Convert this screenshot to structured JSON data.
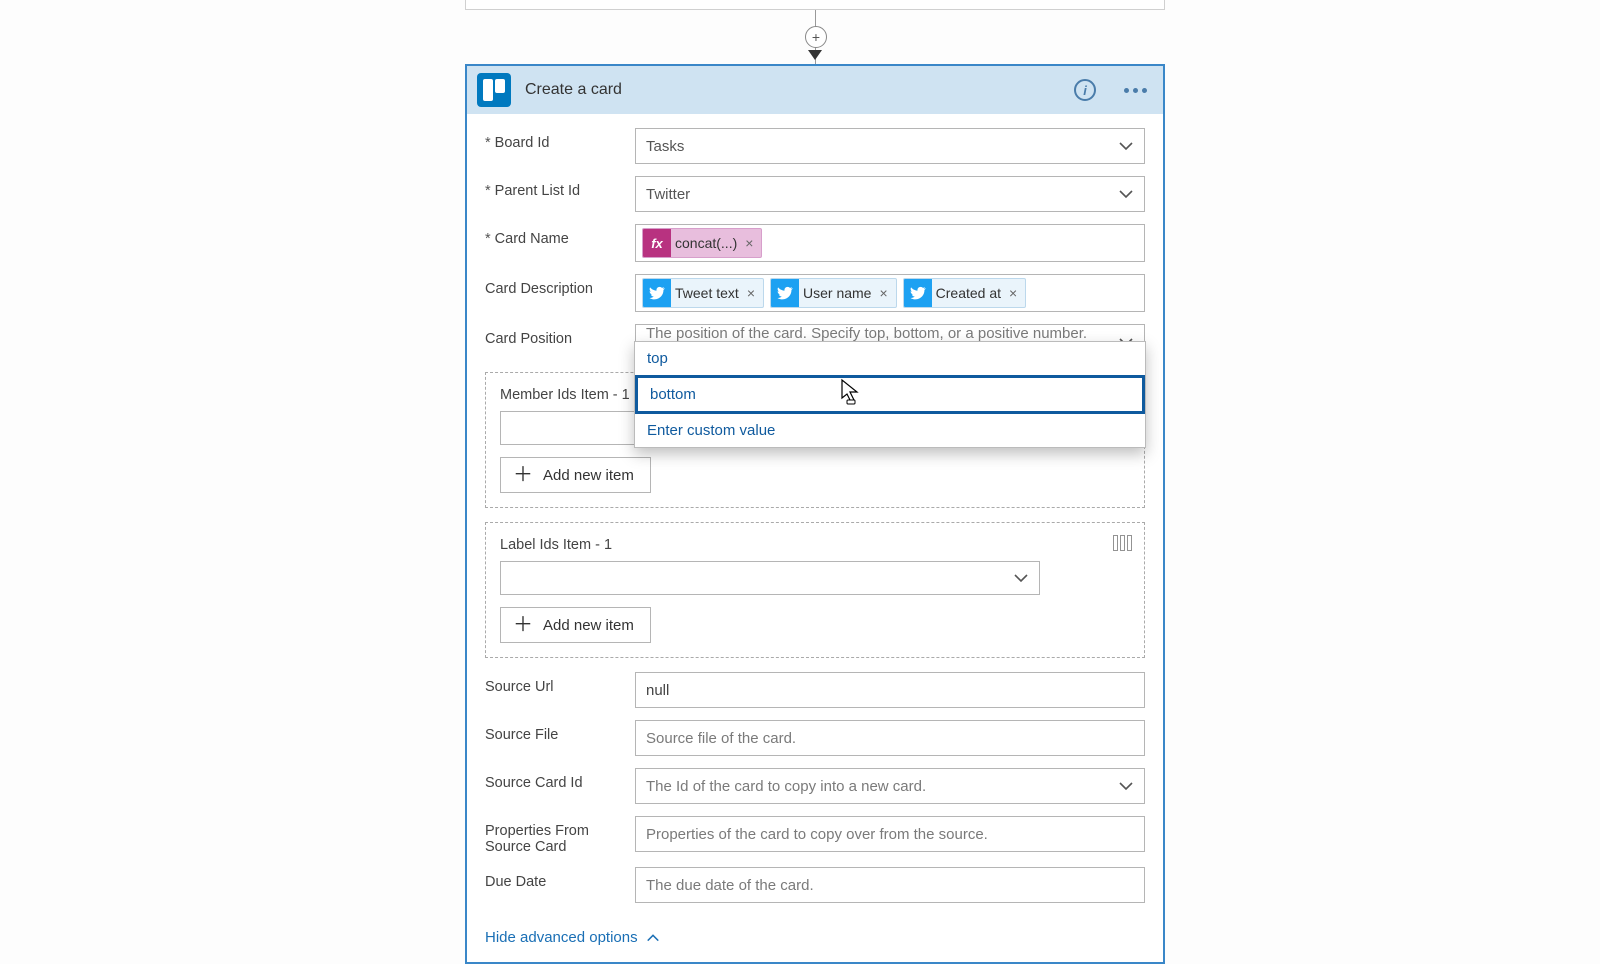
{
  "header": {
    "title": "Create a card"
  },
  "fields": {
    "board_label": "Board Id",
    "board_value": "Tasks",
    "parent_label": "Parent List Id",
    "parent_value": "Twitter",
    "cardname_label": "Card Name",
    "cardname_token": "concat(...)",
    "desc_label": "Card Description",
    "desc_tokens": {
      "t1": "Tweet text",
      "t2": "User name",
      "t3": "Created at"
    },
    "pos_label": "Card Position",
    "pos_placeholder": "The position of the card. Specify top, bottom, or a positive number. Note",
    "members_label": "Member Ids Item - 1",
    "labels_label": "Label Ids Item - 1",
    "add_item": "Add new item",
    "srcurl_label": "Source Url",
    "srcurl_value": "null",
    "srcfile_label": "Source File",
    "srcfile_placeholder": "Source file of the card.",
    "srccard_label": "Source Card Id",
    "srccard_placeholder": "The Id of the card to copy into a new card.",
    "props_label": "Properties From Source Card",
    "props_placeholder": "Properties of the card to copy over from the source.",
    "due_label": "Due Date",
    "due_placeholder": "The due date of the card.",
    "hide_adv": "Hide advanced options"
  },
  "dropdown": {
    "opt1": "top",
    "opt2": "bottom",
    "opt3": "Enter custom value"
  }
}
